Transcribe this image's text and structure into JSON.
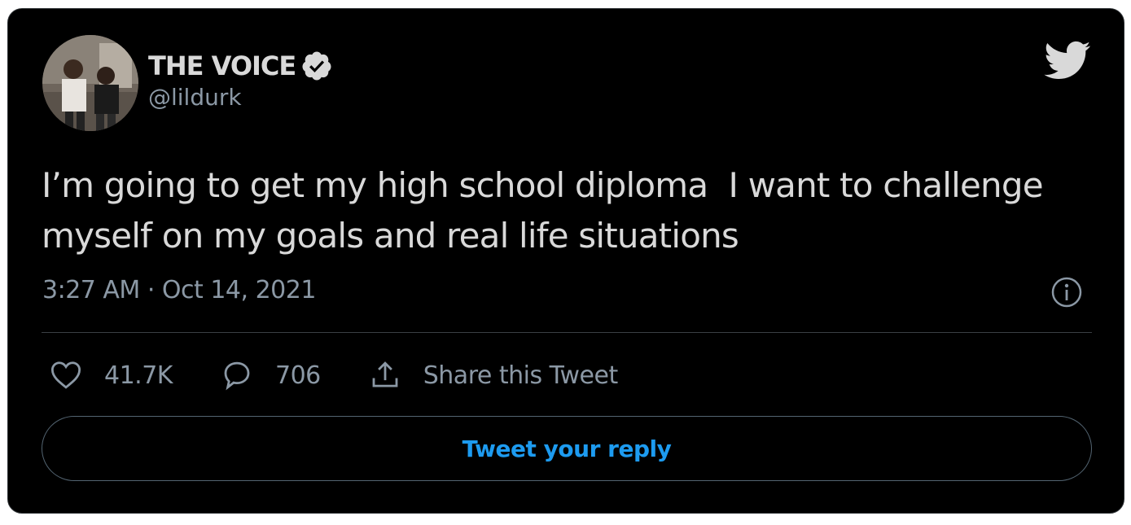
{
  "author": {
    "display_name": "THE VOICE",
    "handle": "@lildurk",
    "verified": true,
    "avatar_icon": "profile-photo"
  },
  "tweet": {
    "text": "I’m going to get my high school diploma  I want to challenge myself on my goals and real life situations",
    "timestamp": "3:27 AM · Oct 14, 2021"
  },
  "actions": {
    "likes_count": "41.7K",
    "replies_count": "706",
    "share_label": "Share this Tweet"
  },
  "reply_button": {
    "label": "Tweet your reply"
  },
  "icons": {
    "brand": "twitter-bird-icon",
    "info": "info-icon",
    "like": "heart-icon",
    "reply": "speech-bubble-icon",
    "share": "share-upload-icon",
    "verified": "verified-badge-icon"
  },
  "colors": {
    "background": "#000000",
    "text_primary": "#d9d9d9",
    "text_secondary": "#8b98a5",
    "accent": "#1d9bf0",
    "border": "#2f3336"
  }
}
